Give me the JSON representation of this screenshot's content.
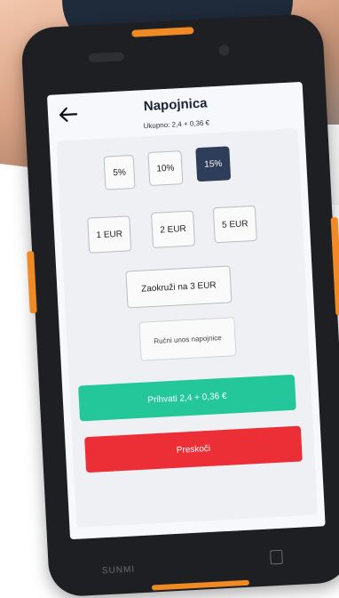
{
  "screen": {
    "title": "Napojnica",
    "subtitle": "Ukupno: 2,4 + 0,36 €",
    "percent_options": [
      {
        "label": "5%",
        "selected": false
      },
      {
        "label": "10%",
        "selected": false
      },
      {
        "label": "15%",
        "selected": true
      }
    ],
    "amount_options": [
      {
        "label": "1 EUR"
      },
      {
        "label": "2 EUR"
      },
      {
        "label": "5 EUR"
      }
    ],
    "round_label": "Zaokruži na 3 EUR",
    "manual_label": "Ručni unos napojnice",
    "accept_label": "Prihvati 2,4 + 0,36 €",
    "skip_label": "Preskoči",
    "icons": {
      "back": "arrow-left-icon"
    }
  },
  "device": {
    "brand": "SUNMI",
    "accent_color": "#f08a24"
  },
  "colors": {
    "selected": "#2d3d5a",
    "accept": "#23c79a",
    "skip": "#ec2f36"
  }
}
